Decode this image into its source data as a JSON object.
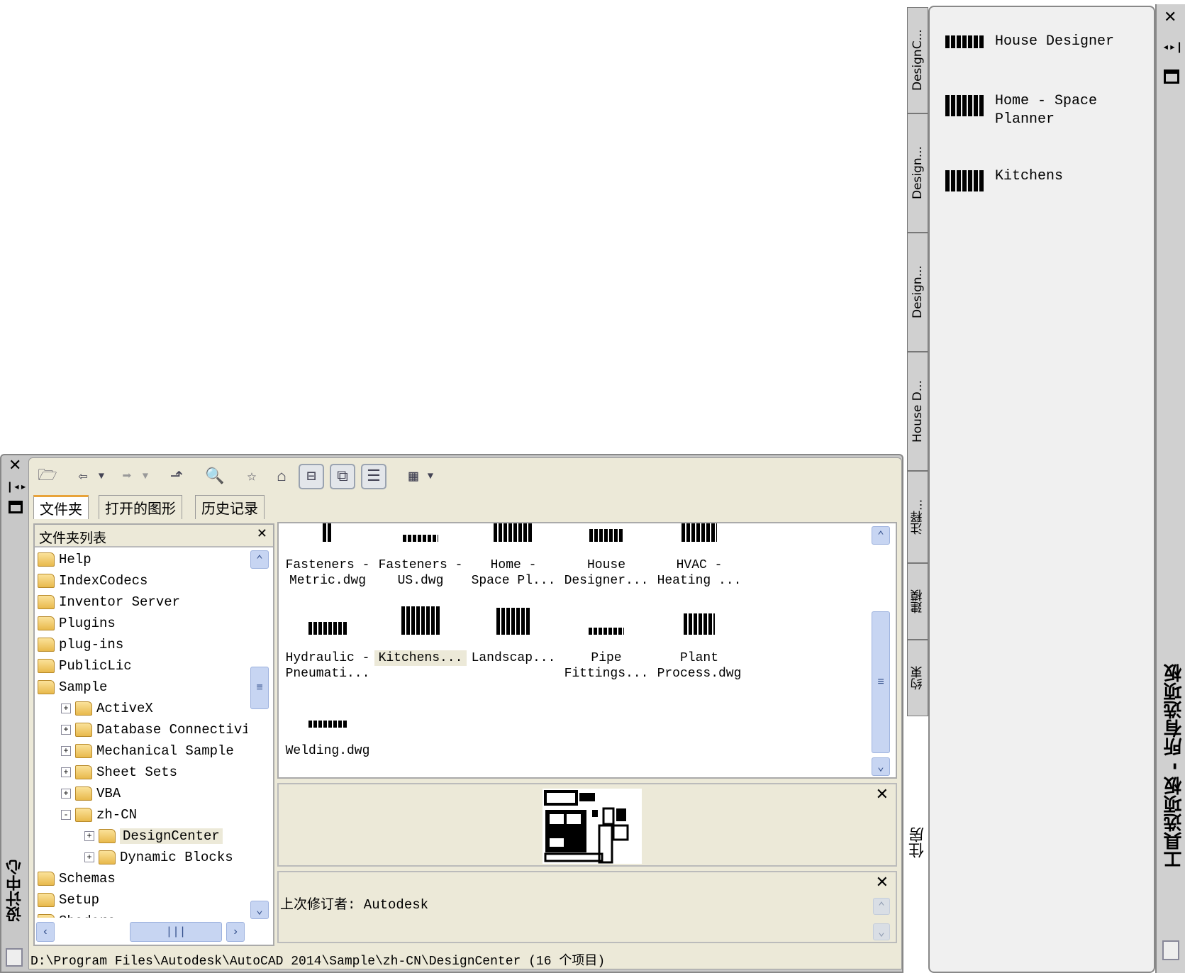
{
  "design_center": {
    "title": "设计中心",
    "toolbar": {
      "icons": [
        "load-icon",
        "back-icon",
        "back-dropdown-icon",
        "forward-icon",
        "forward-dropdown-icon",
        "up-icon",
        "search-icon",
        "favorites-icon",
        "home-icon",
        "tree-toggle-icon",
        "preview-toggle-icon",
        "description-toggle-icon",
        "views-icon",
        "views-dropdown-icon"
      ]
    },
    "tabs": [
      "文件夹",
      "打开的图形",
      "历史记录"
    ],
    "folder_panel": {
      "title": "文件夹列表",
      "items": [
        {
          "label": "Help",
          "level": 0,
          "expander": ""
        },
        {
          "label": "IndexCodecs",
          "level": 0,
          "expander": ""
        },
        {
          "label": "Inventor Server",
          "level": 0,
          "expander": ""
        },
        {
          "label": "Plugins",
          "level": 0,
          "expander": ""
        },
        {
          "label": "plug-ins",
          "level": 0,
          "expander": ""
        },
        {
          "label": "PublicLic",
          "level": 0,
          "expander": ""
        },
        {
          "label": "Sample",
          "level": 0,
          "expander": ""
        },
        {
          "label": "ActiveX",
          "level": 1,
          "expander": "+"
        },
        {
          "label": "Database Connectivity",
          "level": 1,
          "expander": "+"
        },
        {
          "label": "Mechanical Sample",
          "level": 1,
          "expander": "+"
        },
        {
          "label": "Sheet Sets",
          "level": 1,
          "expander": "+"
        },
        {
          "label": "VBA",
          "level": 1,
          "expander": "+"
        },
        {
          "label": "zh-CN",
          "level": 1,
          "expander": "-"
        },
        {
          "label": "DesignCenter",
          "level": 2,
          "expander": "+",
          "selected": true
        },
        {
          "label": "Dynamic Blocks",
          "level": 2,
          "expander": "+"
        },
        {
          "label": "Schemas",
          "level": 0,
          "expander": ""
        },
        {
          "label": "Setup",
          "level": 0,
          "expander": ""
        },
        {
          "label": "Shaders",
          "level": 0,
          "expander": ""
        }
      ]
    },
    "content_items": [
      {
        "line1": "Fasteners -",
        "line2": "Metric.dwg"
      },
      {
        "line1": "Fasteners -",
        "line2": "US.dwg"
      },
      {
        "line1": "Home -",
        "line2": "Space Pl..."
      },
      {
        "line1": "House",
        "line2": "Designer..."
      },
      {
        "line1": "HVAC -",
        "line2": "Heating ..."
      },
      {
        "line1": "Hydraulic -",
        "line2": "Pneumati..."
      },
      {
        "line1": "Kitchens...",
        "line2": "",
        "selected": true
      },
      {
        "line1": "Landscap...",
        "line2": ""
      },
      {
        "line1": "Pipe",
        "line2": "Fittings..."
      },
      {
        "line1": "Plant",
        "line2": "Process.dwg"
      },
      {
        "line1": "Welding.dwg",
        "line2": ""
      }
    ],
    "description": "上次修订者: Autodesk",
    "status_path": "D:\\Program Files\\Autodesk\\AutoCAD 2014\\Sample\\zh-CN\\DesignCenter (16 个项目)"
  },
  "tool_palette": {
    "title": "工具选项板 - 所有选项板",
    "tabs": [
      "DesignC...",
      "Design...",
      "Design...",
      "House D...",
      "注释...",
      "建模",
      "约束",
      "住房"
    ],
    "active_tab": "住房",
    "items": [
      {
        "label": "House Designer"
      },
      {
        "label": "Home - Space Planner"
      },
      {
        "label": "Kitchens"
      }
    ]
  }
}
